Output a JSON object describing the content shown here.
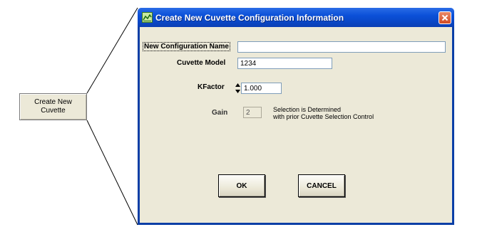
{
  "outer_button": {
    "label": "Create New Cuvette"
  },
  "dialog": {
    "title": "Create New Cuvette Configuration Information",
    "fields": {
      "config_name_label": "New Configuration Name",
      "config_name_value": "",
      "cuvette_model_label": "Cuvette Model",
      "cuvette_model_value": "1234",
      "kfactor_label": "KFactor",
      "kfactor_value": "1.000",
      "gain_label": "Gain",
      "gain_value": "2"
    },
    "gain_note_line1": "Selection is Determined",
    "gain_note_line2": "with prior Cuvette Selection Control",
    "ok_label": "OK",
    "cancel_label": "CANCEL"
  },
  "icons": {
    "app_icon": "chart-icon",
    "close_icon": "close-icon",
    "spinner_icon": "spinner-updown-icon"
  },
  "colors": {
    "titlebar": "#0b50d8",
    "dialog_face": "#ECE9D8",
    "close_button": "#d24a22"
  }
}
